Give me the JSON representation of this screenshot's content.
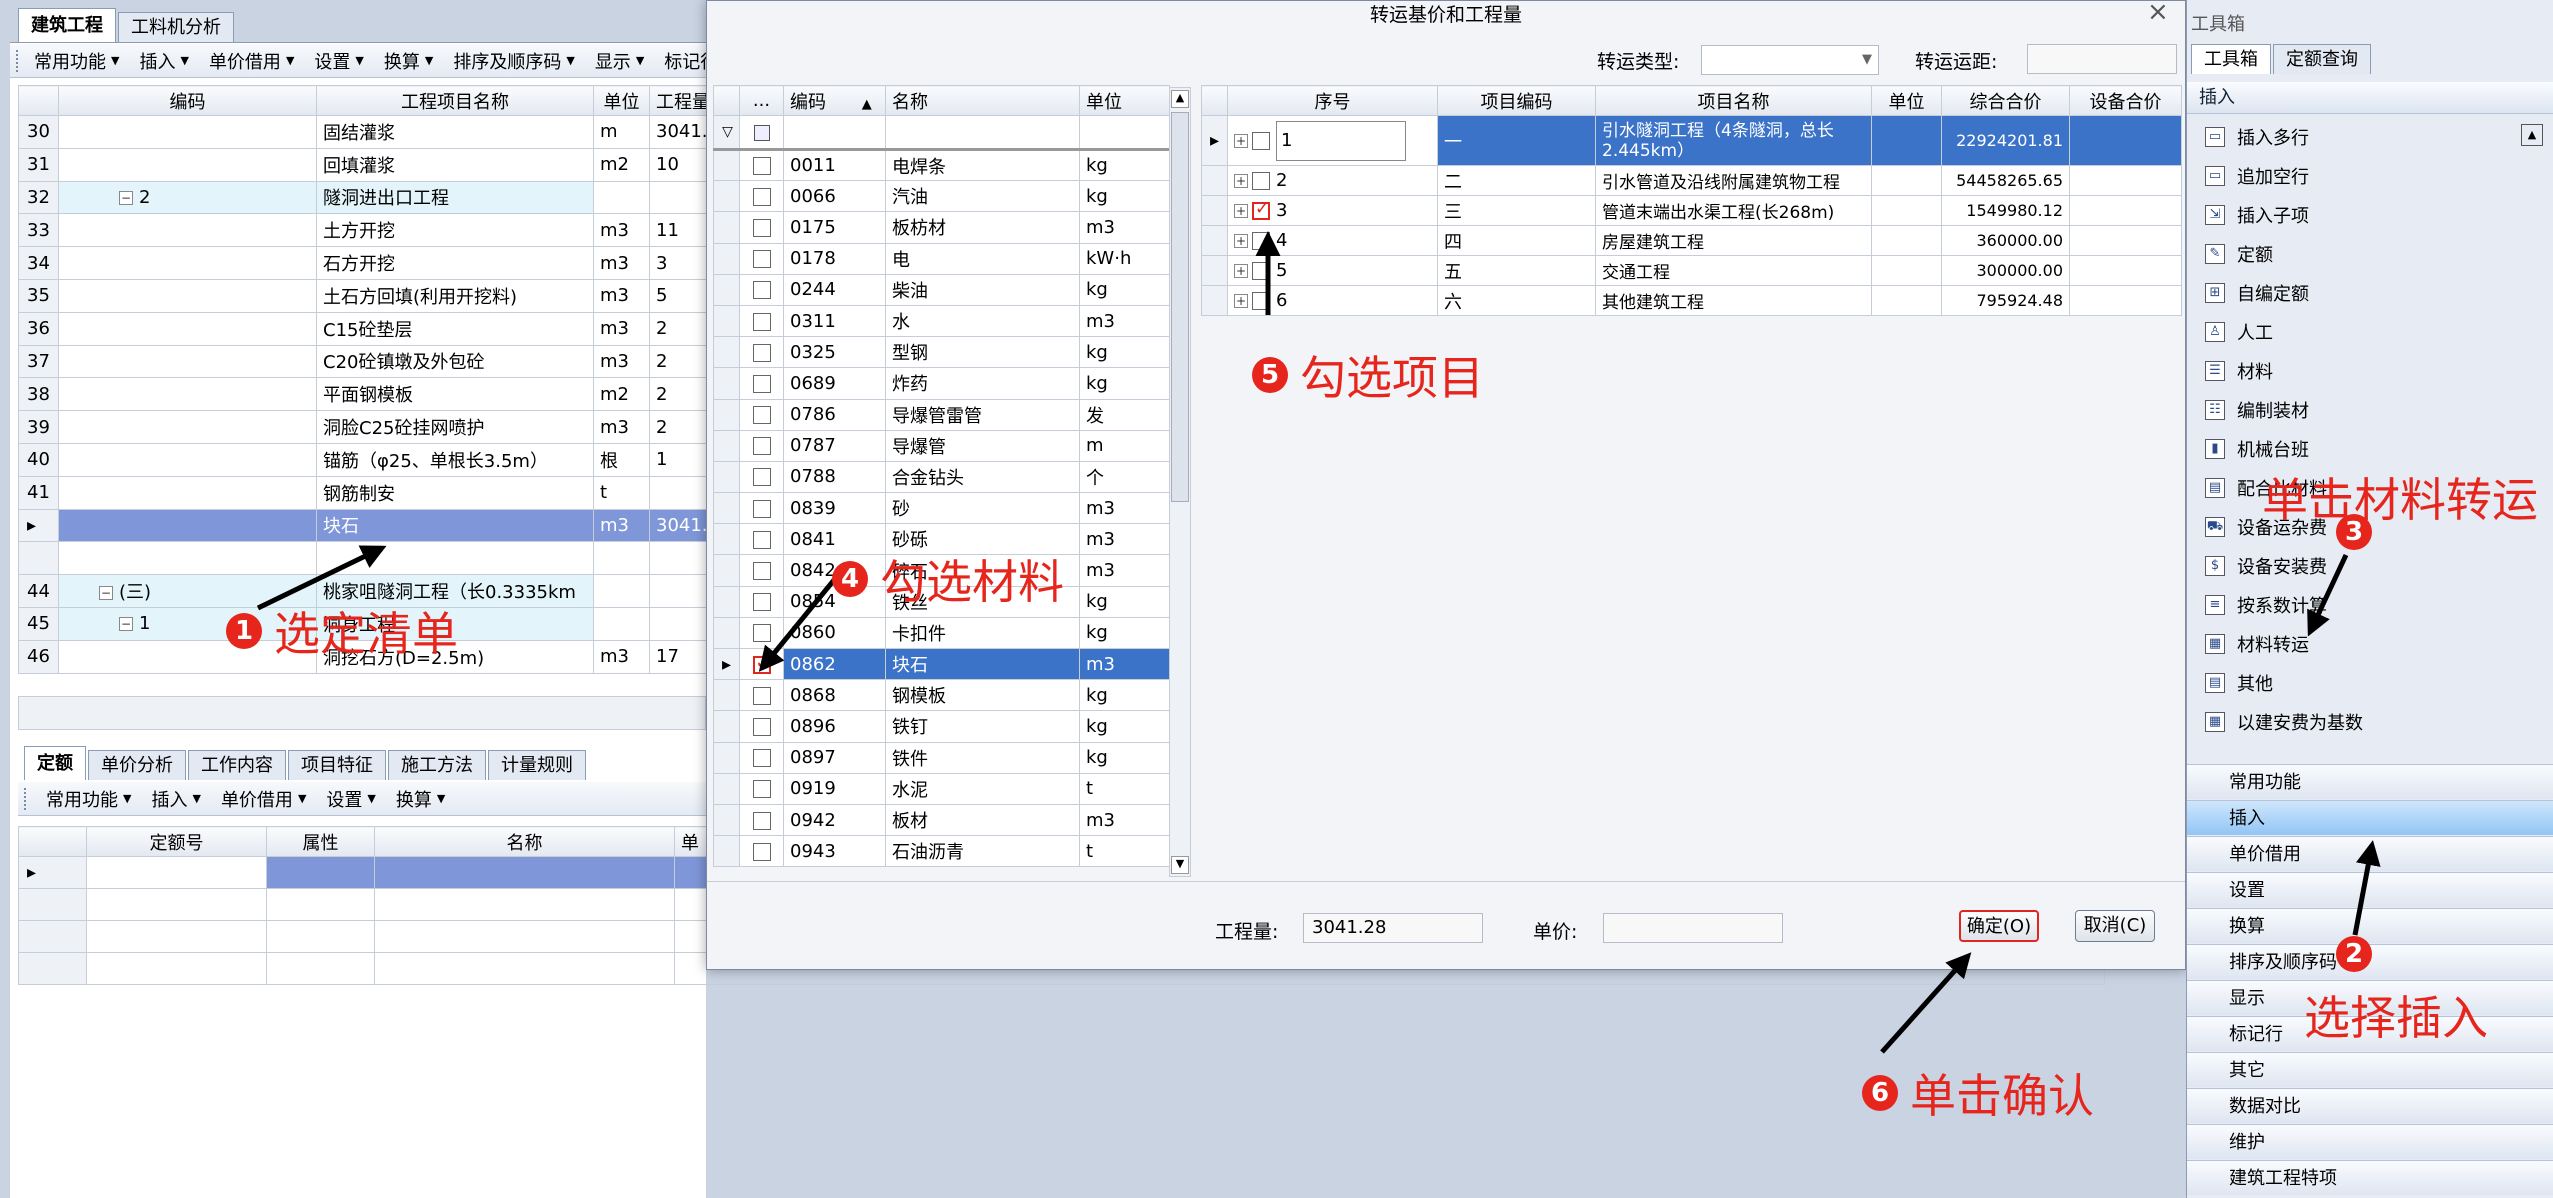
{
  "main": {
    "tabs": [
      "建筑工程",
      "工料机分析"
    ],
    "toolbar": [
      "常用功能",
      "插入",
      "单价借用",
      "设置",
      "换算",
      "排序及顺序码",
      "显示",
      "标记行"
    ],
    "columns": [
      "编码",
      "工程项目名称",
      "单位",
      "工程量"
    ],
    "rows": [
      {
        "num": "30",
        "code": "",
        "name": "固结灌浆",
        "unit": "m",
        "qty": "3041."
      },
      {
        "num": "31",
        "code": "",
        "name": "回填灌浆",
        "unit": "m2",
        "qty": "10"
      },
      {
        "num": "32",
        "code": "2",
        "name": "隧洞进出口工程",
        "unit": "",
        "qty": ""
      },
      {
        "num": "33",
        "code": "",
        "name": "土方开挖",
        "unit": "m3",
        "qty": "11"
      },
      {
        "num": "34",
        "code": "",
        "name": "石方开挖",
        "unit": "m3",
        "qty": "3"
      },
      {
        "num": "35",
        "code": "",
        "name": "土石方回填(利用开挖料)",
        "unit": "m3",
        "qty": "5"
      },
      {
        "num": "36",
        "code": "",
        "name": "C15砼垫层",
        "unit": "m3",
        "qty": "2"
      },
      {
        "num": "37",
        "code": "",
        "name": "C20砼镇墩及外包砼",
        "unit": "m3",
        "qty": "2"
      },
      {
        "num": "38",
        "code": "",
        "name": "平面钢模板",
        "unit": "m2",
        "qty": "2"
      },
      {
        "num": "39",
        "code": "",
        "name": "洞脸C25砼挂网喷护",
        "unit": "m3",
        "qty": "2"
      },
      {
        "num": "40",
        "code": "",
        "name": "锚筋（φ25、单根长3.5m）",
        "unit": "根",
        "qty": "1"
      },
      {
        "num": "41",
        "code": "",
        "name": "钢筋制安",
        "unit": "t",
        "qty": ""
      },
      {
        "num": "▸",
        "code": "",
        "name": "块石",
        "unit": "m3",
        "qty": "3041."
      },
      {
        "num": "",
        "code": "",
        "name": "",
        "unit": "",
        "qty": ""
      },
      {
        "num": "44",
        "code": "(三)",
        "name": "桃家咀隧洞工程（长0.3335km",
        "unit": "",
        "qty": ""
      },
      {
        "num": "45",
        "code": "1",
        "name": "洞身工程",
        "unit": "",
        "qty": ""
      },
      {
        "num": "46",
        "code": "",
        "name": "洞挖石方(D=2.5m)",
        "unit": "m3",
        "qty": "17"
      }
    ],
    "lower_tabs": [
      "定额",
      "单价分析",
      "工作内容",
      "项目特征",
      "施工方法",
      "计量规则"
    ],
    "lower_toolbar": [
      "常用功能",
      "插入",
      "单价借用",
      "设置",
      "换算"
    ],
    "lower_columns": [
      "定额号",
      "属性",
      "名称",
      "单"
    ]
  },
  "dialog": {
    "title": "转运基价和工程量",
    "transport_type_label": "转运类型:",
    "transport_distance_label": "转运运距:",
    "material_columns": [
      "...",
      "编码",
      "名称",
      "单位"
    ],
    "materials": [
      {
        "code": "0011",
        "name": "电焊条",
        "unit": "kg",
        "checked": false
      },
      {
        "code": "0066",
        "name": "汽油",
        "unit": "kg",
        "checked": false
      },
      {
        "code": "0175",
        "name": "板枋材",
        "unit": "m3",
        "checked": false
      },
      {
        "code": "0178",
        "name": "电",
        "unit": "kW·h",
        "checked": false
      },
      {
        "code": "0244",
        "name": "柴油",
        "unit": "kg",
        "checked": false
      },
      {
        "code": "0311",
        "name": "水",
        "unit": "m3",
        "checked": false
      },
      {
        "code": "0325",
        "name": "型钢",
        "unit": "kg",
        "checked": false
      },
      {
        "code": "0689",
        "name": "炸药",
        "unit": "kg",
        "checked": false
      },
      {
        "code": "0786",
        "name": "导爆管雷管",
        "unit": "发",
        "checked": false
      },
      {
        "code": "0787",
        "name": "导爆管",
        "unit": "m",
        "checked": false
      },
      {
        "code": "0788",
        "name": "合金钻头",
        "unit": "个",
        "checked": false
      },
      {
        "code": "0839",
        "name": "砂",
        "unit": "m3",
        "checked": false
      },
      {
        "code": "0841",
        "name": "砂砾",
        "unit": "m3",
        "checked": false
      },
      {
        "code": "0842",
        "name": "碎石",
        "unit": "m3",
        "checked": false
      },
      {
        "code": "0854",
        "name": "铁丝",
        "unit": "kg",
        "checked": false
      },
      {
        "code": "0860",
        "name": "卡扣件",
        "unit": "kg",
        "checked": false
      },
      {
        "code": "0862",
        "name": "块石",
        "unit": "m3",
        "checked": true
      },
      {
        "code": "0868",
        "name": "钢模板",
        "unit": "kg",
        "checked": false
      },
      {
        "code": "0896",
        "name": "铁钉",
        "unit": "kg",
        "checked": false
      },
      {
        "code": "0897",
        "name": "铁件",
        "unit": "kg",
        "checked": false
      },
      {
        "code": "0919",
        "name": "水泥",
        "unit": "t",
        "checked": false
      },
      {
        "code": "0942",
        "name": "板材",
        "unit": "m3",
        "checked": false
      },
      {
        "code": "0943",
        "name": "石油沥青",
        "unit": "t",
        "checked": false
      }
    ],
    "project_columns": [
      "序号",
      "项目编码",
      "项目名称",
      "单位",
      "综合合价",
      "设备合价"
    ],
    "projects": [
      {
        "seq": "1",
        "code": "一",
        "name": "引水隧洞工程（4条隧洞，总长2.445km）",
        "unit": "",
        "total": "22924201.81",
        "checked": false
      },
      {
        "seq": "2",
        "code": "二",
        "name": "引水管道及沿线附属建筑物工程",
        "unit": "",
        "total": "54458265.65",
        "checked": false
      },
      {
        "seq": "3",
        "code": "三",
        "name": "管道末端出水渠工程(长268m)",
        "unit": "",
        "total": "1549980.12",
        "checked": true
      },
      {
        "seq": "4",
        "code": "四",
        "name": "房屋建筑工程",
        "unit": "",
        "total": "360000.00",
        "checked": false
      },
      {
        "seq": "5",
        "code": "五",
        "name": "交通工程",
        "unit": "",
        "total": "300000.00",
        "checked": false
      },
      {
        "seq": "6",
        "code": "六",
        "name": "其他建筑工程",
        "unit": "",
        "total": "795924.48",
        "checked": false
      }
    ],
    "qty_label": "工程量:",
    "qty_value": "3041.28",
    "price_label": "单价:",
    "ok_label": "确定(O)",
    "cancel_label": "取消(C)"
  },
  "toolbox": {
    "title": "工具箱",
    "tabs": [
      "工具箱",
      "定额查询"
    ],
    "section": "插入",
    "items": [
      "插入多行",
      "追加空行",
      "插入子项",
      "定额",
      "自编定额",
      "人工",
      "材料",
      "编制装材",
      "机械台班",
      "配合比材料",
      "设备运杂费",
      "设备安装费",
      "按系数计算",
      "材料转运",
      "其他",
      "以建安费为基数"
    ],
    "groups": [
      "常用功能",
      "插入",
      "单价借用",
      "设置",
      "换算",
      "排序及顺序码",
      "显示",
      "标记行",
      "其它",
      "数据对比",
      "维护",
      "建筑工程特项"
    ]
  },
  "annotations": [
    {
      "n": "1",
      "text": "选定清单"
    },
    {
      "n": "2",
      "text": "选择插入"
    },
    {
      "n": "3",
      "text": "单击材料转运"
    },
    {
      "n": "4",
      "text": "勾选材料"
    },
    {
      "n": "5",
      "text": "勾选项目"
    },
    {
      "n": "6",
      "text": "单击确认"
    }
  ],
  "colors": {
    "annotation": "#e6251c",
    "selection": "#3b73c9"
  }
}
